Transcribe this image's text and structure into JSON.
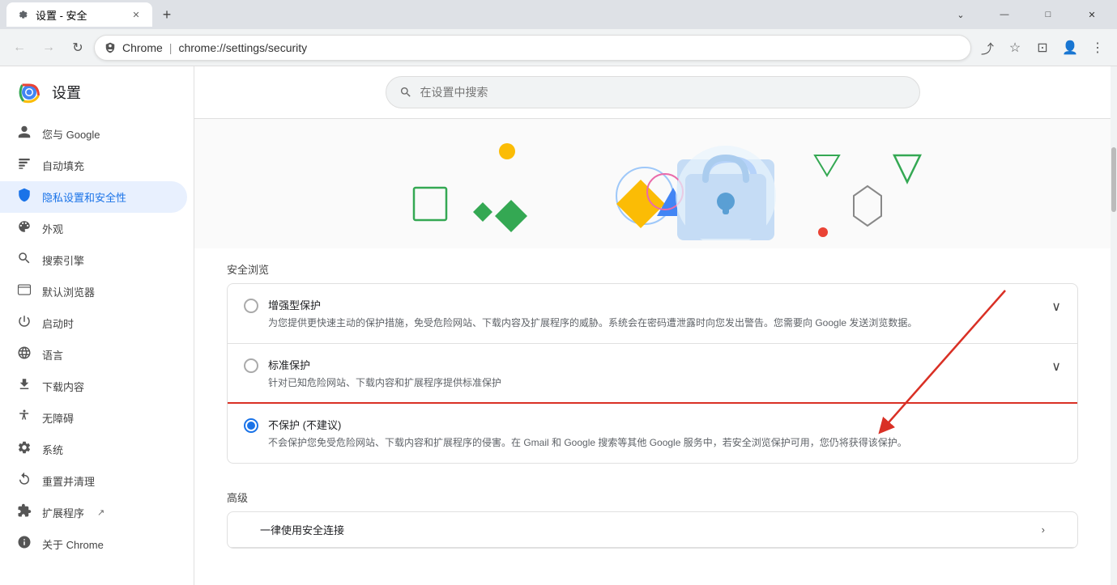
{
  "window": {
    "title": "设置 - 安全",
    "tab_label": "设置 - 安全",
    "new_tab_label": "+"
  },
  "titlebar": {
    "controls": {
      "minimize": "—",
      "maximize": "□",
      "close": "✕"
    },
    "chevron": "⌄"
  },
  "navbar": {
    "back_title": "后退",
    "forward_title": "前进",
    "refresh_title": "刷新",
    "brand": "Chrome",
    "separator": "|",
    "url": "chrome://settings/security"
  },
  "settings": {
    "header": "设置",
    "search_placeholder": "在设置中搜索"
  },
  "sidebar": {
    "items": [
      {
        "id": "google",
        "label": "您与 Google",
        "icon": "👤"
      },
      {
        "id": "autofill",
        "label": "自动填充",
        "icon": "📋"
      },
      {
        "id": "privacy",
        "label": "隐私设置和安全性",
        "icon": "🛡",
        "active": true
      },
      {
        "id": "appearance",
        "label": "外观",
        "icon": "🎨"
      },
      {
        "id": "search",
        "label": "搜索引擎",
        "icon": "🔍"
      },
      {
        "id": "browser",
        "label": "默认浏览器",
        "icon": "🖥"
      },
      {
        "id": "startup",
        "label": "启动时",
        "icon": "⏻"
      },
      {
        "id": "language",
        "label": "语言",
        "icon": "🌐"
      },
      {
        "id": "downloads",
        "label": "下载内容",
        "icon": "⬇"
      },
      {
        "id": "accessibility",
        "label": "无障碍",
        "icon": "♿"
      },
      {
        "id": "system",
        "label": "系统",
        "icon": "🔧"
      },
      {
        "id": "reset",
        "label": "重置并清理",
        "icon": "🔄"
      },
      {
        "id": "extensions",
        "label": "扩展程序",
        "icon": "🧩"
      },
      {
        "id": "about",
        "label": "关于 Chrome",
        "icon": "ℹ"
      }
    ]
  },
  "content": {
    "section_safe_browsing": "安全浏览",
    "option_enhanced": {
      "title": "增强型保护",
      "desc": "为您提供更快速主动的保护措施，免受危险网站、下载内容及扩展程序的威胁。系统会在密码遭泄露时向您发出警告。您需要向 Google 发送浏览数据。"
    },
    "option_standard": {
      "title": "标准保护",
      "desc": "针对已知危险网站、下载内容和扩展程序提供标准保护"
    },
    "option_none": {
      "title": "不保护 (不建议)",
      "desc": "不会保护您免受危险网站、下载内容和扩展程序的侵害。在 Gmail 和 Google 搜索等其他 Google 服务中，若安全浏览保护可用，您仍将获得该保护。"
    },
    "section_advanced": "高级",
    "advanced_item_1": "一律使用安全连接"
  }
}
